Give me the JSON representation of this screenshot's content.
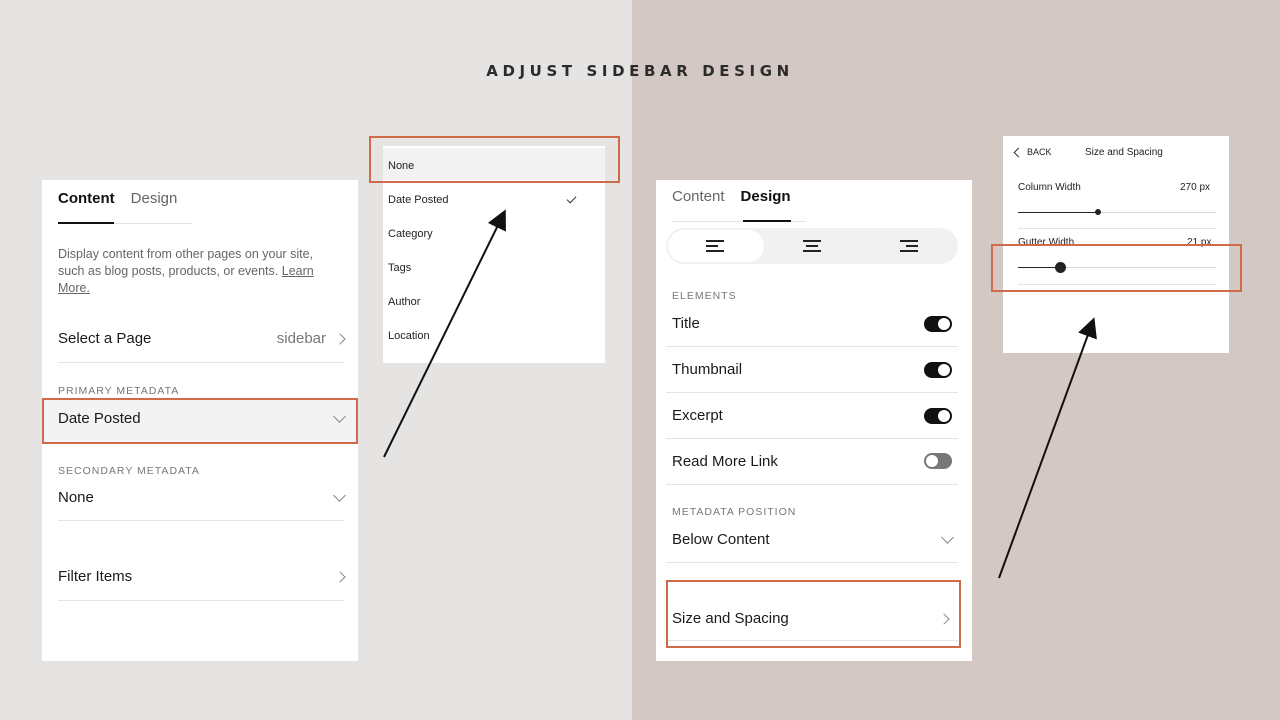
{
  "heading": "ADJUST SIDEBAR DESIGN",
  "colors": {
    "highlight": "#cf6a4a",
    "bg_left": "#e6e4e2",
    "bg_right": "#d3c8c4"
  },
  "panel_content": {
    "tabs": [
      "Content",
      "Design"
    ],
    "description": "Display content from other pages on your site, such as blog posts, products, or events.",
    "learn_more": "Learn More.",
    "select_page_label": "Select a Page",
    "select_page_value": "sidebar",
    "primary_metadata_label": "PRIMARY METADATA",
    "primary_metadata_value": "Date Posted",
    "secondary_metadata_label": "SECONDARY METADATA",
    "secondary_metadata_value": "None",
    "filter_items_label": "Filter Items"
  },
  "dropdown": {
    "options": [
      "None",
      "Date Posted",
      "Category",
      "Tags",
      "Author",
      "Location"
    ],
    "checked": "Date Posted"
  },
  "panel_design": {
    "tabs": [
      "Content",
      "Design"
    ],
    "alignment_options": [
      "align-left",
      "align-center",
      "align-right"
    ],
    "elements_label": "ELEMENTS",
    "elements": [
      {
        "label": "Title",
        "on": true
      },
      {
        "label": "Thumbnail",
        "on": true
      },
      {
        "label": "Excerpt",
        "on": true
      },
      {
        "label": "Read More Link",
        "on": false
      }
    ],
    "metadata_position_label": "METADATA POSITION",
    "metadata_position_value": "Below Content",
    "size_spacing_label": "Size and Spacing"
  },
  "panel_size": {
    "back_label": "BACK",
    "title": "Size and Spacing",
    "column_width_label": "Column Width",
    "column_width_value": "270 px",
    "gutter_width_label": "Gutter Width",
    "gutter_width_value": "21 px"
  }
}
